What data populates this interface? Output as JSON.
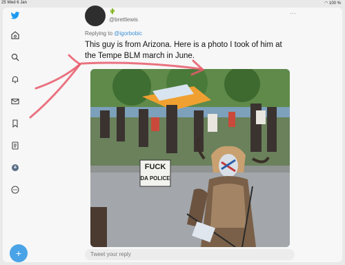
{
  "status": {
    "time": "25 Wed 6 Jan",
    "battery": "100 %"
  },
  "sidebar": {
    "items": [
      "twitter-logo",
      "home-icon",
      "explore-icon",
      "notifications-icon",
      "messages-icon",
      "bookmarks-icon",
      "lists-icon",
      "profile-icon",
      "more-icon"
    ],
    "compose_icon": "+"
  },
  "tweet": {
    "badge": "🌵",
    "handle": "@brettlewis",
    "replying_prefix": "Replying to ",
    "replying_to": "@igorbobic",
    "text": "This guy is from Arizona. Here is a photo I took of him at the Tempe BLM march in June.",
    "more_icon": "···"
  },
  "photo": {
    "sign_line1": "FUCK",
    "sign_line2": "DA POLICE"
  },
  "compose": {
    "placeholder": "Tweet your reply"
  },
  "colors": {
    "accent": "#1d9bf0",
    "annotation": "#e85a6b"
  }
}
